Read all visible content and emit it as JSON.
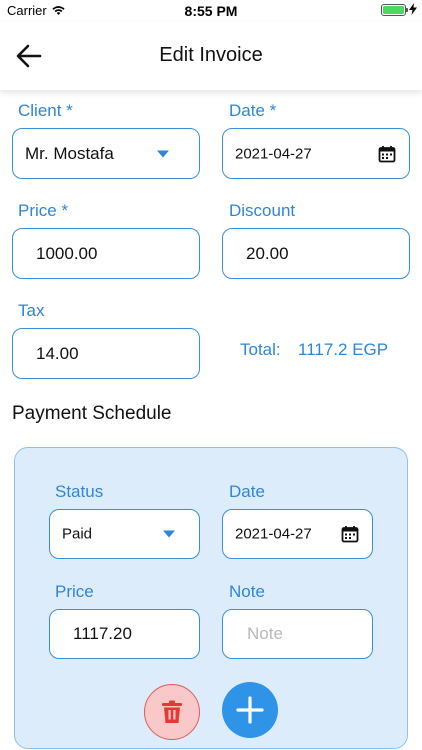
{
  "status_bar": {
    "carrier": "Carrier",
    "time": "8:55 PM",
    "battery_level": 1.0
  },
  "nav": {
    "title": "Edit Invoice",
    "back_icon": "arrow-left-icon"
  },
  "form": {
    "client": {
      "label": "Client *",
      "value": "Mr. Mostafa"
    },
    "date": {
      "label": "Date *",
      "value": "2021-04-27"
    },
    "price": {
      "label": "Price *",
      "value": "1000.00"
    },
    "discount": {
      "label": "Discount",
      "value": "20.00"
    },
    "tax": {
      "label": "Tax",
      "value": "14.00"
    },
    "total": {
      "label": "Total:",
      "value": "1117.2 EGP"
    }
  },
  "payment_schedule": {
    "title": "Payment Schedule",
    "status": {
      "label": "Status",
      "value": "Paid"
    },
    "date": {
      "label": "Date",
      "value": "2021-04-27"
    },
    "price": {
      "label": "Price",
      "value": "1117.20"
    },
    "note": {
      "label": "Note",
      "placeholder": "Note",
      "value": ""
    },
    "delete_icon": "trash-icon",
    "add_icon": "plus-icon"
  },
  "colors": {
    "accent": "#2f86d6",
    "field_border": "#3a8fdc",
    "card_bg": "#dcecfb",
    "add_button": "#2f93e8",
    "delete_bg": "#f9c9c9",
    "delete_icon": "#e53935"
  }
}
